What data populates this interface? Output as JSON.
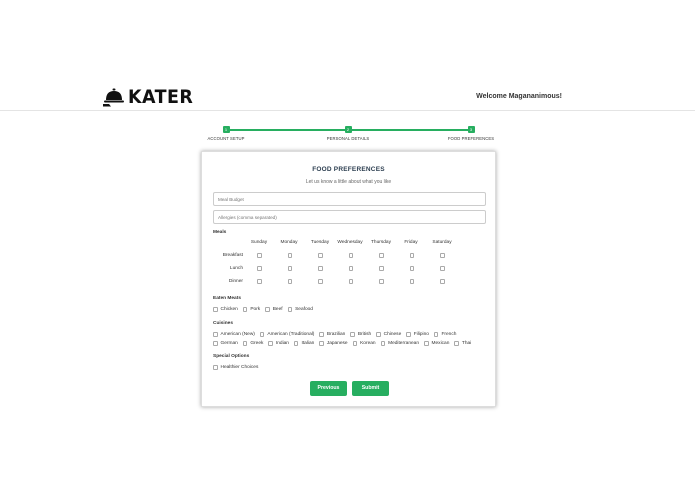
{
  "brand": {
    "name": "KATER",
    "icon": "cloche-icon"
  },
  "header": {
    "welcome": "Welcome Magananimous!"
  },
  "progress": {
    "steps": [
      {
        "label": "ACCOUNT SETUP",
        "number": "1"
      },
      {
        "label": "PERSONAL DETAILS",
        "number": "2"
      },
      {
        "label": "FOOD PREFERENCES",
        "number": "3"
      }
    ],
    "color": "#27ae60"
  },
  "form": {
    "title": "FOOD PREFERENCES",
    "subtitle": "Let us know a little about what you like",
    "meal_budget": {
      "placeholder": "Meal Budget",
      "value": ""
    },
    "allergies": {
      "placeholder": "Allergies (comma separated)",
      "value": ""
    },
    "meals": {
      "title": "Meals",
      "days": [
        "Sunday",
        "Monday",
        "Tuesday",
        "Wednesday",
        "Thursday",
        "Friday",
        "Saturday"
      ],
      "meals": [
        "Breakfast",
        "Lunch",
        "Dinner"
      ]
    },
    "eaten_meats": {
      "title": "Eaten Meats",
      "options": [
        "Chicken",
        "Pork",
        "Beef",
        "Seafood"
      ]
    },
    "cuisines": {
      "title": "Cuisines",
      "row1": [
        "American (New)",
        "American (Traditional)",
        "Brazilian",
        "British",
        "Chinese",
        "Filipino",
        "French"
      ],
      "row2": [
        "German",
        "Greek",
        "Indian",
        "Italian",
        "Japanese",
        "Korean",
        "Mediterranean",
        "Mexican",
        "Thai"
      ]
    },
    "special_options": {
      "title": "Special Options",
      "options": [
        "Healthier Choices"
      ]
    },
    "buttons": {
      "previous": "Previous",
      "submit": "Submit"
    }
  }
}
